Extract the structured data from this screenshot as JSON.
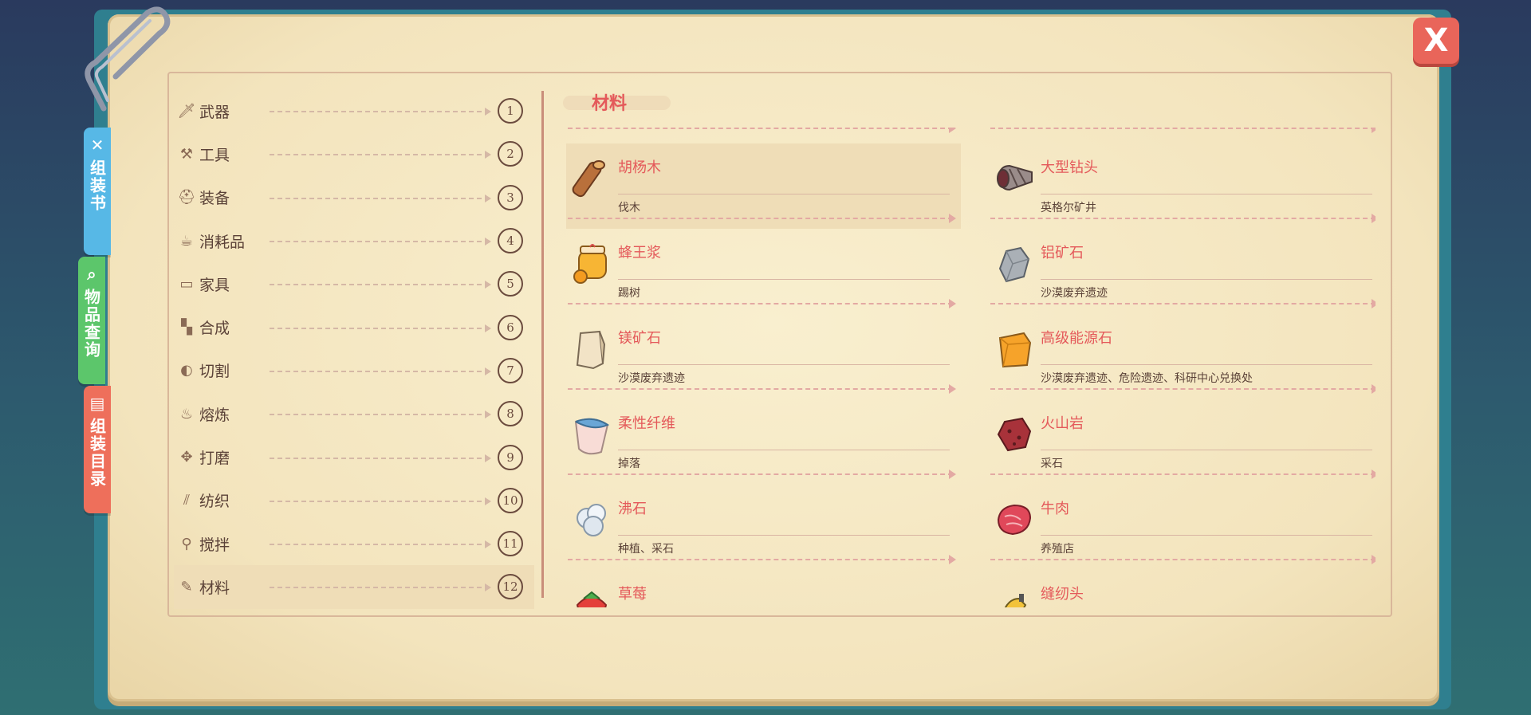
{
  "window": {
    "close_label": "X"
  },
  "side_tabs": [
    {
      "label": "组装书",
      "icon": "wrench-icon",
      "color": "#57b8e6"
    },
    {
      "label": "物品查询",
      "icon": "magnifier-icon",
      "color": "#5cc66b"
    },
    {
      "label": "组装目录",
      "icon": "catalog-icon",
      "color": "#ee6f5b"
    }
  ],
  "categories": [
    {
      "label": "武器",
      "num": "1",
      "icon": "sword-icon"
    },
    {
      "label": "工具",
      "num": "2",
      "icon": "hammer-icon"
    },
    {
      "label": "装备",
      "num": "3",
      "icon": "helmet-icon"
    },
    {
      "label": "消耗品",
      "num": "4",
      "icon": "food-icon"
    },
    {
      "label": "家具",
      "num": "5",
      "icon": "furniture-icon"
    },
    {
      "label": "合成",
      "num": "6",
      "icon": "blocks-icon"
    },
    {
      "label": "切割",
      "num": "7",
      "icon": "saw-icon"
    },
    {
      "label": "熔炼",
      "num": "8",
      "icon": "flame-icon"
    },
    {
      "label": "打磨",
      "num": "9",
      "icon": "grinder-icon"
    },
    {
      "label": "纺织",
      "num": "10",
      "icon": "thread-icon"
    },
    {
      "label": "搅拌",
      "num": "11",
      "icon": "whisk-icon"
    },
    {
      "label": "材料",
      "num": "12",
      "icon": "material-icon",
      "active": true
    }
  ],
  "section": {
    "title": "材料"
  },
  "items_left": [
    {
      "name": "胡杨木",
      "source": "伐木",
      "icon": "wood-log-icon",
      "selected": true
    },
    {
      "name": "蜂王浆",
      "source": "踢树",
      "icon": "honey-jar-icon"
    },
    {
      "name": "镁矿石",
      "source": "沙漠废弃遗迹",
      "icon": "magnesium-ore-icon"
    },
    {
      "name": "柔性纤维",
      "source": "掉落",
      "icon": "fiber-roll-icon"
    },
    {
      "name": "沸石",
      "source": "种植、采石",
      "icon": "zeolite-icon"
    },
    {
      "name": "草莓",
      "source": "",
      "icon": "strawberry-icon"
    }
  ],
  "items_right": [
    {
      "name": "大型钻头",
      "source": "英格尔矿井",
      "icon": "drill-bit-icon"
    },
    {
      "name": "铝矿石",
      "source": "沙漠废弃遗迹",
      "icon": "aluminum-ore-icon"
    },
    {
      "name": "高级能源石",
      "source": "沙漠废弃遗迹、危险遗迹、科研中心兑换处",
      "icon": "energy-stone-icon"
    },
    {
      "name": "火山岩",
      "source": "采石",
      "icon": "volcanic-rock-icon"
    },
    {
      "name": "牛肉",
      "source": "养殖店",
      "icon": "beef-icon"
    },
    {
      "name": "缝纫头",
      "source": "",
      "icon": "sewing-head-icon"
    }
  ]
}
